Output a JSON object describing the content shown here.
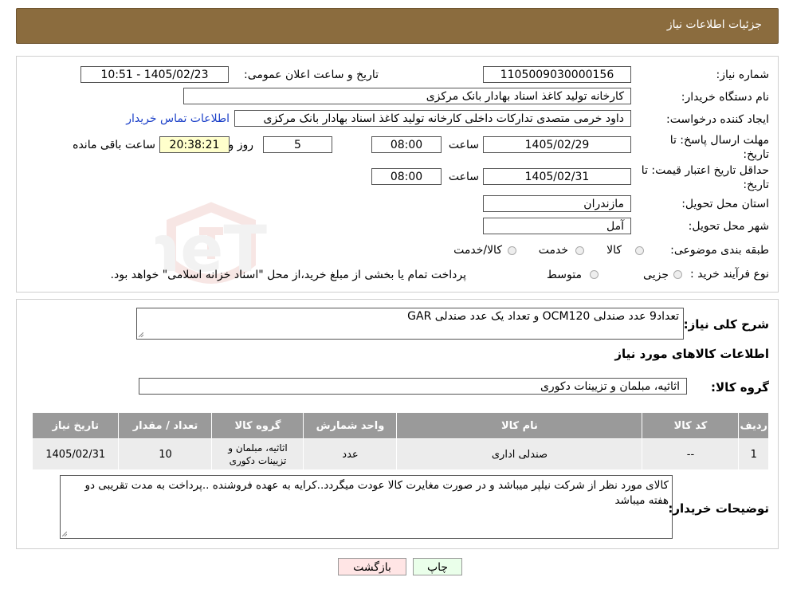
{
  "header": {
    "title": "جزئیات اطلاعات نیاز"
  },
  "form": {
    "need_number_label": "شماره نیاز:",
    "need_number": "1105009030000156",
    "announce_label": "تاریخ و ساعت اعلان عمومی:",
    "announce_value": "1405/02/23 - 10:51",
    "buyer_org_label": "نام دستگاه خریدار:",
    "buyer_org": "کارخانه تولید کاغذ اسناد بهادار بانک مرکزی",
    "creator_label": "ایجاد کننده درخواست:",
    "creator": "داود خرمی متصدی تدارکات داخلی کارخانه تولید کاغذ اسناد بهادار بانک مرکزی",
    "contact_link": "اطلاعات تماس خریدار",
    "reply_deadline_label": "مهلت ارسال پاسخ: تا تاریخ:",
    "reply_date": "1405/02/29",
    "time_label": "ساعت",
    "reply_time": "08:00",
    "days_value": "5",
    "days_label": "روز و",
    "remaining_time": "20:38:21",
    "remaining_label": "ساعت باقی مانده",
    "price_validity_label": "حداقل تاریخ اعتبار قیمت: تا تاریخ:",
    "price_date": "1405/02/31",
    "price_time": "08:00",
    "province_label": "استان محل تحویل:",
    "province": "مازندران",
    "city_label": "شهر محل تحویل:",
    "city": "آمل",
    "category_label": "طبقه بندی موضوعی:",
    "category_options": [
      "کالا",
      "خدمت",
      "کالا/خدمت"
    ],
    "process_label": "نوع فرآیند خرید :",
    "process_options": [
      "جزیی",
      "متوسط"
    ],
    "process_note": "پرداخت تمام یا بخشی از مبلغ خرید،از محل \"اسناد خزانه اسلامی\" خواهد بود."
  },
  "summary": {
    "desc_label": "شرح کلی نیاز:",
    "desc_value": "تعداد9 عدد صندلی OCM120 و تعداد یک عدد صندلی GAR",
    "goods_info_title": "اطلاعات کالاهای مورد نیاز",
    "group_label": "گروه کالا:",
    "group_value": "اثاثیه، مبلمان و تزیینات دکوری"
  },
  "table": {
    "headers": [
      "ردیف",
      "کد کالا",
      "نام کالا",
      "واحد شمارش",
      "گروه کالا",
      "تعداد / مقدار",
      "تاریخ نیاز"
    ],
    "rows": [
      [
        "1",
        "--",
        "صندلی اداری",
        "عدد",
        "اثاثیه، مبلمان و تزیینات دکوری",
        "10",
        "1405/02/31"
      ]
    ]
  },
  "buyer_notes": {
    "label": "توضیحات خریدار:",
    "text": "کالای مورد نظر از شرکت نیلپر میباشد و در صورت مغایرت کالا عودت میگردد..کرایه به عهده فروشنده ..پرداخت به مدت تقریبی دو هفته میباشد"
  },
  "buttons": {
    "print": "چاپ",
    "back": "بازگشت"
  },
  "watermark": {
    "text": "AriaTender.neT"
  },
  "colors": {
    "header": "#8b6c3e",
    "table_header": "#9a9a9a",
    "print_btn": "#eaffea",
    "back_btn": "#ffe5e5"
  }
}
